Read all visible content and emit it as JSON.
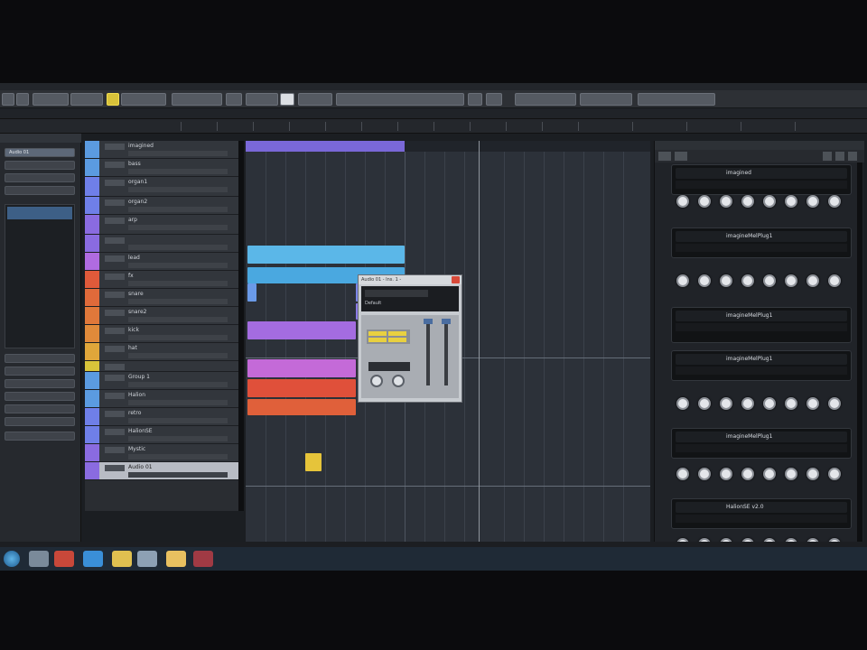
{
  "window": {
    "title": ""
  },
  "inspector": {
    "selected_track_label": "Audio 01",
    "tabs": [
      "",
      ""
    ]
  },
  "tracks": [
    {
      "name": "imagined",
      "color": "#5b9be0"
    },
    {
      "name": "bass",
      "color": "#5b9be0"
    },
    {
      "name": "organ1",
      "color": "#6f7fe8"
    },
    {
      "name": "organ2",
      "color": "#6f7fe8"
    },
    {
      "name": "arp",
      "color": "#8a6be0"
    },
    {
      "name": "",
      "color": "#8a6be0"
    },
    {
      "name": "lead",
      "color": "#b06be0"
    },
    {
      "name": "fx",
      "color": "#e05a3a"
    },
    {
      "name": "snare",
      "color": "#e06a3a"
    },
    {
      "name": "snare2",
      "color": "#e0783a"
    },
    {
      "name": "kick",
      "color": "#e08a3a"
    },
    {
      "name": "hat",
      "color": "#e0a63a"
    },
    {
      "name": "",
      "color": "#d8c43a"
    },
    {
      "name": "Group 1",
      "color": "#5b9be0"
    },
    {
      "name": "Halion",
      "color": "#5b9be0"
    },
    {
      "name": "retro",
      "color": "#6f7fe8"
    },
    {
      "name": "HalionSE",
      "color": "#6f7fe8"
    },
    {
      "name": "Mystic",
      "color": "#8a6be0"
    },
    {
      "name": "Audio 01",
      "color": "#8a6be0"
    }
  ],
  "plugin_window": {
    "title": "Audio 01 - Ins. 1 - ",
    "preset": "Default"
  },
  "rack": {
    "header_left": "",
    "header_right": "",
    "slots": [
      {
        "name": "imagined"
      },
      {
        "name": "imagineMelPlug1"
      },
      {
        "name": "imagineMelPlug1"
      },
      {
        "name": "imagineMelPlug1"
      },
      {
        "name": "imagineMelPlug1"
      },
      {
        "name": "HalionSE v2.0"
      }
    ]
  },
  "taskbar": {
    "clock_time": "",
    "clock_date": ""
  }
}
